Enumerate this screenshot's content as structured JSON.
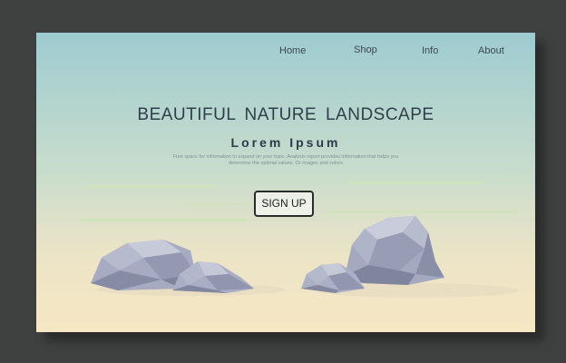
{
  "nav": {
    "items": [
      {
        "label": "Home"
      },
      {
        "label": "Shop"
      },
      {
        "label": "Info"
      },
      {
        "label": "About"
      }
    ]
  },
  "hero": {
    "title": "BEAUTIFUL  NATURE  LANDSCAPE",
    "subtitle": "Lorem Ipsum",
    "description": "Free space for information to expand on your topic. Analysis report provides information that helps you determine the optimal values. Or images and colors",
    "cta_label": "SIGN UP"
  },
  "colors": {
    "sky_top": "#9ecbd0",
    "sky_bottom": "#f6e7c4",
    "frame": "#3f4140",
    "rock_light": "#b9bccf",
    "rock_dark": "#8d92ab"
  }
}
